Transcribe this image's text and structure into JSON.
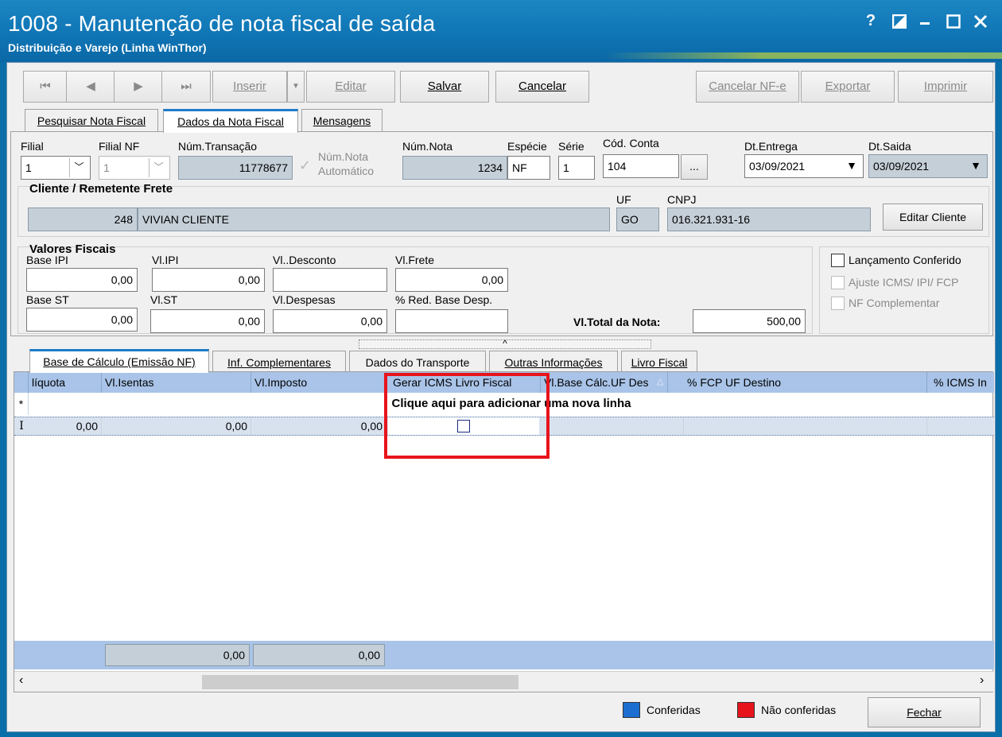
{
  "window": {
    "title": "1008 - Manutenção de nota fiscal de saída",
    "subtitle": "Distribuição e Varejo (Linha WinThor)",
    "help_label": "?"
  },
  "toolbar": {
    "first": "⏮",
    "prev": "◀",
    "next": "▶",
    "last": "⏭",
    "inserir": "Inserir",
    "editar": "Editar",
    "salvar": "Salvar",
    "cancelar": "Cancelar",
    "cancelar_nfe": "Cancelar NF-e",
    "exportar": "Exportar",
    "imprimir": "Imprimir"
  },
  "tabs": {
    "pesquisar": "Pesquisar Nota Fiscal",
    "dados": "Dados da Nota Fiscal",
    "mensagens": "Mensagens"
  },
  "header_fields": {
    "filial_label": "Filial",
    "filial_value": "1",
    "filial_nf_label": "Filial NF",
    "filial_nf_value": "1",
    "num_transacao_label": "Núm.Transação",
    "num_transacao_value": "11778677",
    "num_nota_auto_label_1": "Núm.Nota",
    "num_nota_auto_label_2": "Automático",
    "num_nota_label": "Núm.Nota",
    "num_nota_value": "1234",
    "especie_label": "Espécie",
    "especie_value": "NF",
    "serie_label": "Série",
    "serie_value": "1",
    "cod_conta_label": "Cód. Conta",
    "cod_conta_value": "104",
    "cod_conta_btn": "...",
    "dt_entrega_label": "Dt.Entrega",
    "dt_entrega_value": "03/09/2021",
    "dt_saida_label": "Dt.Saida",
    "dt_saida_value": "03/09/2021"
  },
  "cliente": {
    "section_title": "Cliente / Remetente Frete",
    "code": "248",
    "name": "VIVIAN CLIENTE",
    "uf_label": "UF",
    "uf_value": "GO",
    "cnpj_label": "CNPJ",
    "cnpj_value": "016.321.931-16",
    "edit_button": "Editar Cliente"
  },
  "valores": {
    "section_title": "Valores Fiscais",
    "base_ipi_label": "Base IPI",
    "base_ipi_value": "0,00",
    "vl_ipi_label": "Vl.IPI",
    "vl_ipi_value": "0,00",
    "vl_desconto_label": "Vl..Desconto",
    "vl_desconto_value": "",
    "vl_frete_label": "Vl.Frete",
    "vl_frete_value": "0,00",
    "base_st_label": "Base ST",
    "base_st_value": "0,00",
    "vl_st_label": "Vl.ST",
    "vl_st_value": "0,00",
    "vl_despesas_label": "Vl.Despesas",
    "vl_despesas_value": "0,00",
    "red_base_label": "% Red. Base Desp.",
    "red_base_value": "",
    "total_label": "Vl.Total da Nota:",
    "total_value": "500,00"
  },
  "options": {
    "lancamento": "Lançamento Conferido",
    "ajuste": "Ajuste ICMS/ IPI/ FCP",
    "complementar": "NF Complementar"
  },
  "lower_tabs": {
    "base": "Base de Cálculo (Emissão NF)",
    "inf": "Inf. Complementares",
    "transporte": "Dados do Transporte",
    "outras": "Outras Informações",
    "livro": "Livro Fiscal"
  },
  "grid": {
    "columns": [
      "líquota",
      "Vl.Isentas",
      "Vl.Imposto",
      "Gerar ICMS Livro Fiscal",
      "Vl.Base Cálc.UF Des",
      "% FCP UF Destino",
      "% ICMS In"
    ],
    "new_row_marker": "*",
    "new_row_text": "Clique aqui para adicionar uma nova linha",
    "row_marker": "I",
    "row": [
      "0,00",
      "0,00",
      "0,00"
    ],
    "footer": [
      "0,00",
      "0,00"
    ]
  },
  "footer": {
    "conferidas": "Conferidas",
    "nao_conferidas": "Não conferidas",
    "fechar": "Fechar",
    "colors": {
      "conferidas": "#1c6fd0",
      "nao_conferidas": "#e8141c",
      "highlight": "#e8141c"
    }
  }
}
